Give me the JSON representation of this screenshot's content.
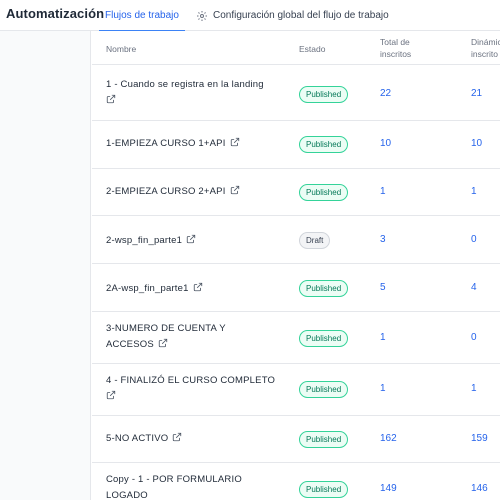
{
  "header": {
    "title": "Automatización",
    "tabs": [
      {
        "label": "Flujos de trabajo"
      },
      {
        "label": "Configuración global del flujo de trabajo"
      }
    ]
  },
  "table": {
    "columns": {
      "name": "Nombre",
      "status": "Estado",
      "total_line1": "Total de",
      "total_line2": "inscritos",
      "dyn_line1": "Dinámic",
      "dyn_line2": "inscrito"
    },
    "rows": [
      {
        "name": "1 - Cuando se registra en la landing",
        "status": "Published",
        "total": "22",
        "dynamic": "21"
      },
      {
        "name": "1-EMPIEZA CURSO 1+API",
        "status": "Published",
        "total": "10",
        "dynamic": "10"
      },
      {
        "name": "2-EMPIEZA CURSO 2+API",
        "status": "Published",
        "total": "1",
        "dynamic": "1"
      },
      {
        "name": "2-wsp_fin_parte1",
        "status": "Draft",
        "total": "3",
        "dynamic": "0"
      },
      {
        "name": "2A-wsp_fin_parte1",
        "status": "Published",
        "total": "5",
        "dynamic": "4"
      },
      {
        "name": "3-NUMERO DE CUENTA Y ACCESOS",
        "status": "Published",
        "total": "1",
        "dynamic": "0"
      },
      {
        "name": "4 - FINALIZÓ EL CURSO COMPLETO",
        "status": "Published",
        "total": "1",
        "dynamic": "1"
      },
      {
        "name": "5-NO ACTIVO",
        "status": "Published",
        "total": "162",
        "dynamic": "159"
      },
      {
        "name": "Copy - 1 - POR FORMULARIO LOGADO",
        "status": "Published",
        "total": "149",
        "dynamic": "146"
      }
    ]
  },
  "icons": {
    "external_link": "external-link-icon",
    "settings": "gear-icon"
  },
  "colors": {
    "accent": "#2563eb",
    "published_text": "#047857",
    "published_border": "#34d399"
  }
}
